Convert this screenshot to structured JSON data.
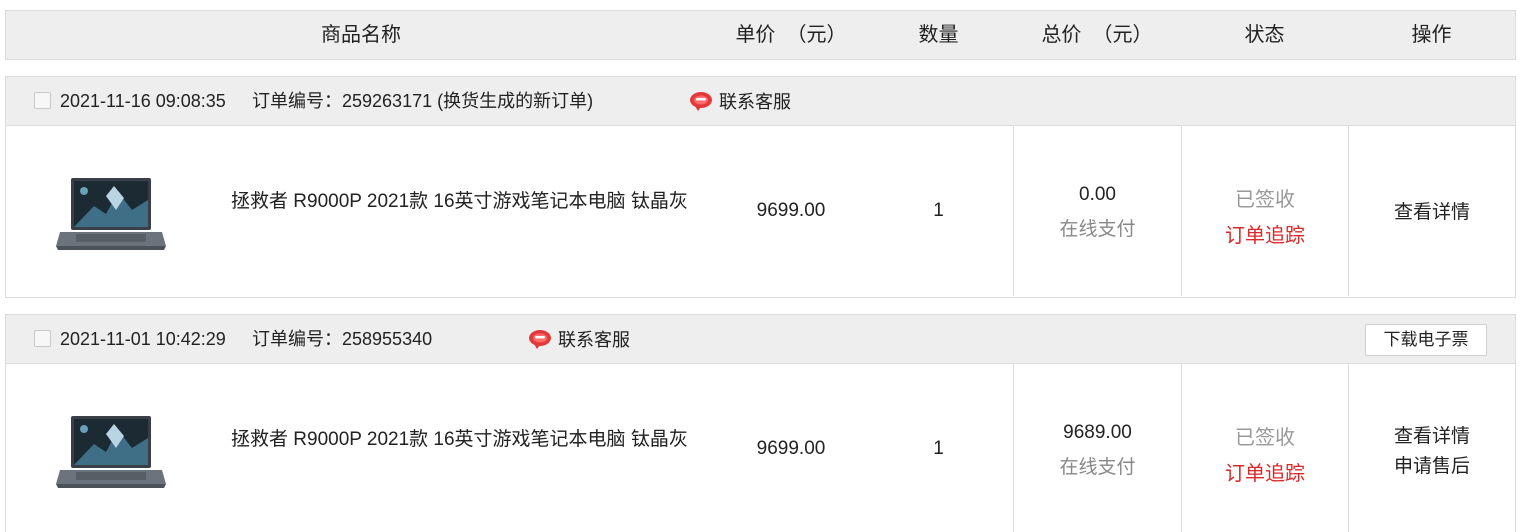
{
  "columns": {
    "product": "商品名称",
    "unit_price": "单价  （元）",
    "quantity": "数量",
    "total": "总价  （元）",
    "status": "状态",
    "action": "操作"
  },
  "orders": [
    {
      "date": "2021-11-16 09:08:35",
      "order_no": "订单编号：259263171",
      "note": "(换货生成的新订单)",
      "service": "联系客服",
      "invoice": "",
      "product_name": "拯救者 R9000P 2021款 16英寸游戏笔记本电脑 钛晶灰",
      "price": "9699.00",
      "quantity": "1",
      "total": "0.00",
      "pay_method": "在线支付",
      "status": "已签收",
      "track": "订单追踪",
      "actions": [
        "查看详情"
      ]
    },
    {
      "date": "2021-11-01 10:42:29",
      "order_no": "订单编号：258955340",
      "note": "",
      "service": "联系客服",
      "invoice": "下载电子票",
      "product_name": "拯救者 R9000P 2021款 16英寸游戏笔记本电脑 钛晶灰",
      "price": "9699.00",
      "quantity": "1",
      "total": "9689.00",
      "pay_method": "在线支付",
      "status": "已签收",
      "track": "订单追踪",
      "actions": [
        "查看详情",
        "申请售后"
      ]
    }
  ],
  "icons": {
    "service": "customer-service-icon",
    "product": "laptop-product-image"
  },
  "colors": {
    "accent_red": "#d9292b",
    "header_bg": "#eeeeee",
    "muted_text": "#888888"
  }
}
